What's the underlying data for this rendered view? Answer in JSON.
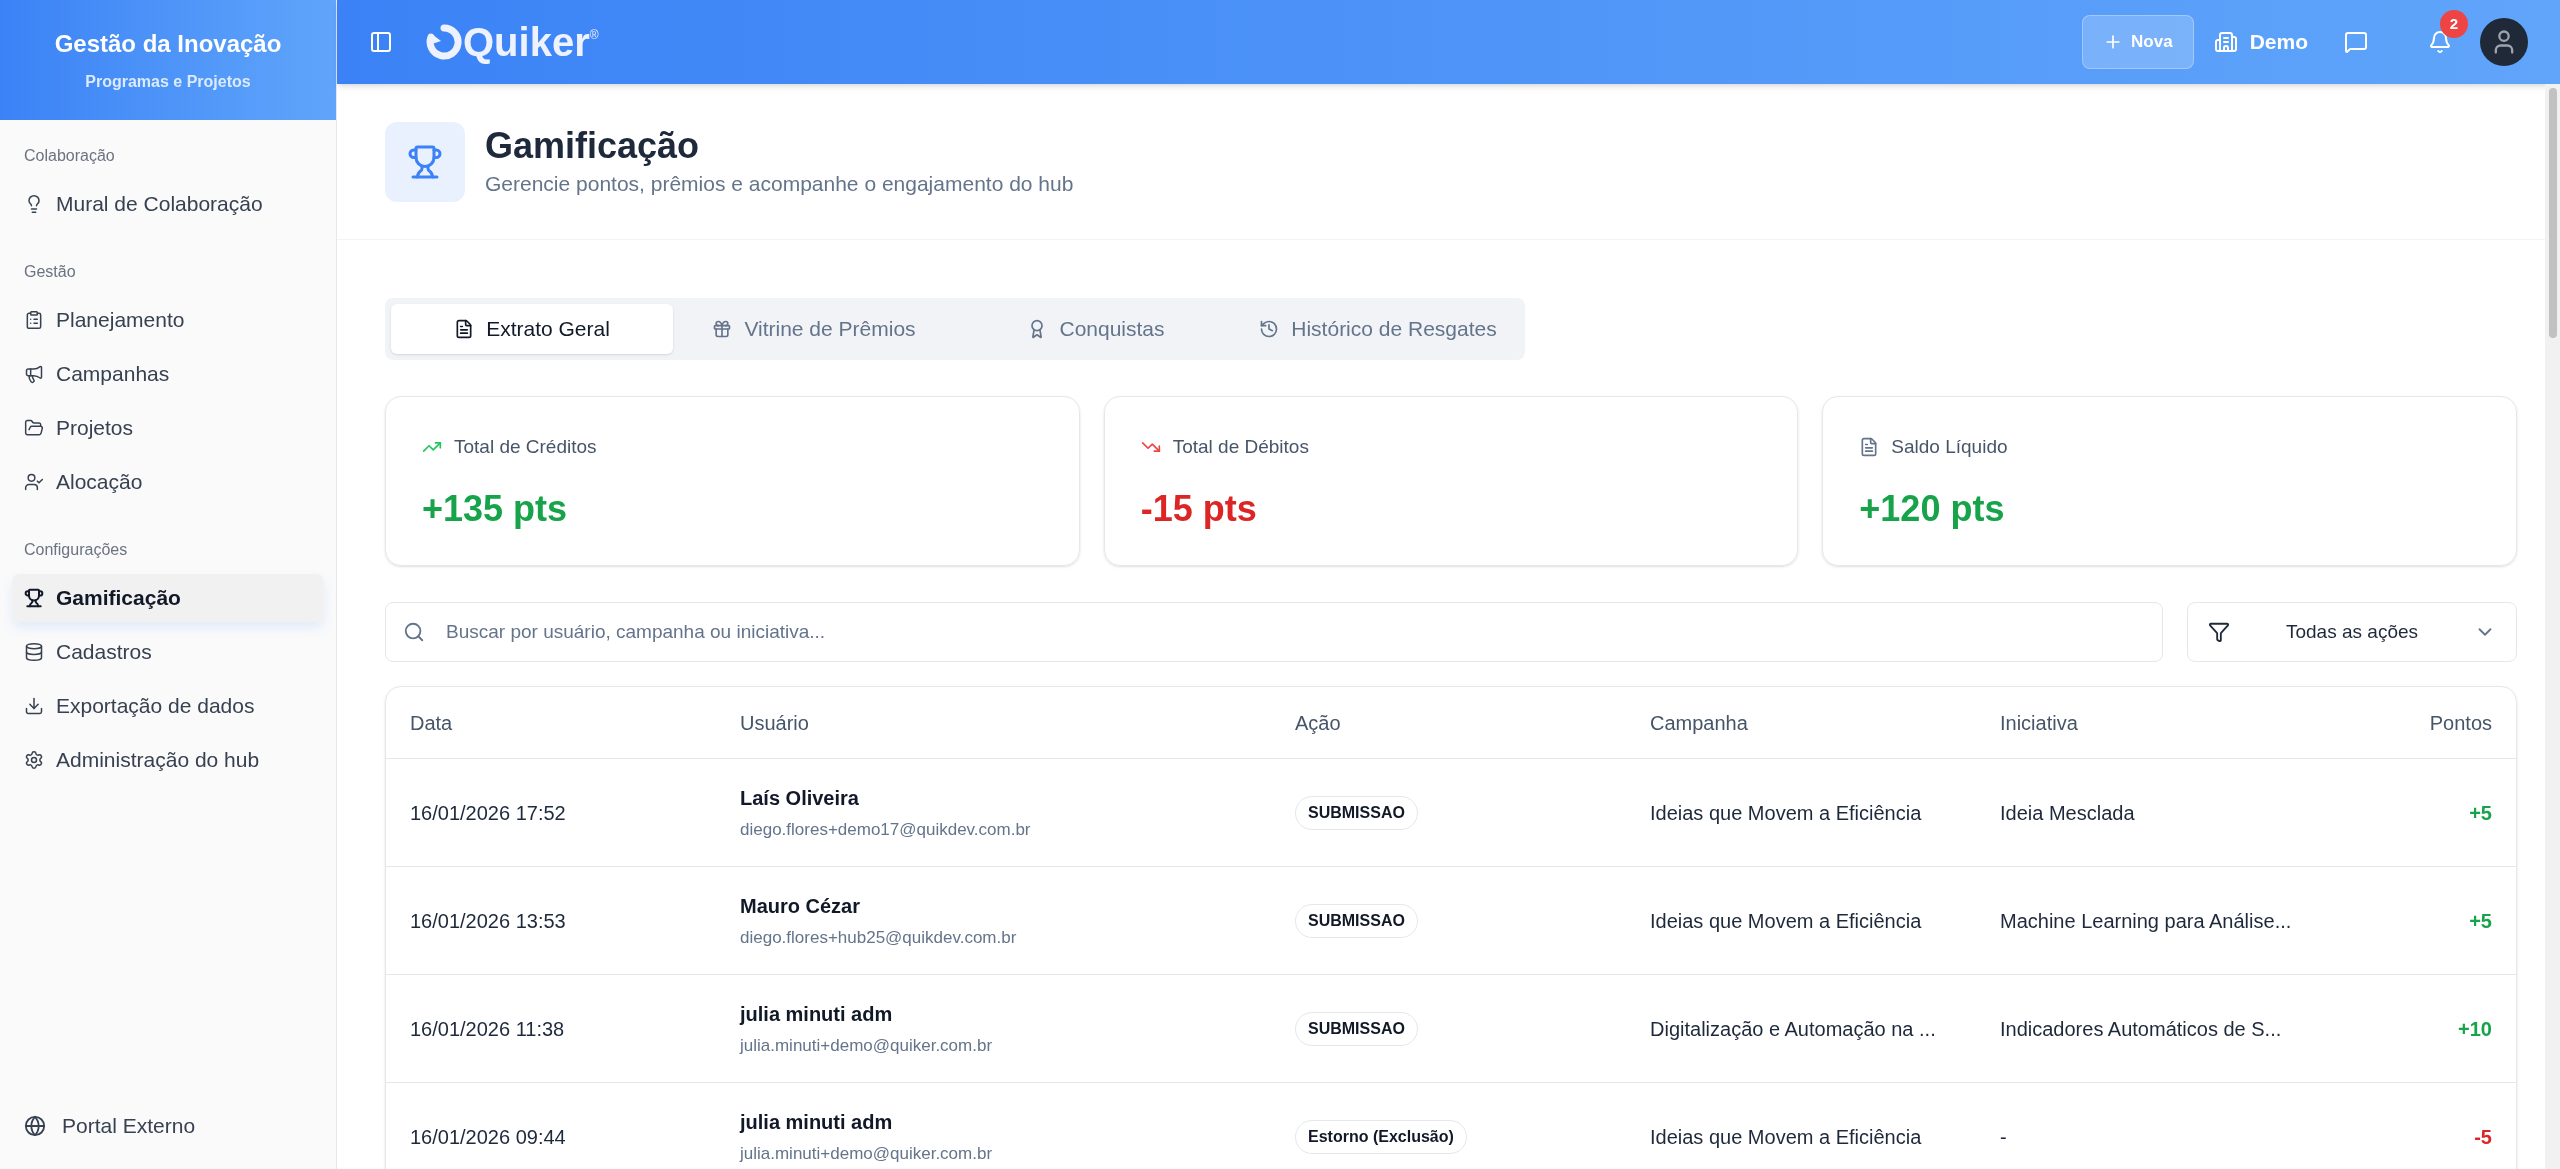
{
  "sidebar": {
    "title": "Gestão da Inovação",
    "subtitle": "Programas e Projetos",
    "sections": [
      {
        "heading": "Colaboração",
        "items": [
          {
            "label": "Mural de Colaboração",
            "selected": false
          }
        ]
      },
      {
        "heading": "Gestão",
        "items": [
          {
            "label": "Planejamento",
            "selected": false
          },
          {
            "label": "Campanhas",
            "selected": false
          },
          {
            "label": "Projetos",
            "selected": false
          },
          {
            "label": "Alocação",
            "selected": false
          }
        ]
      },
      {
        "heading": "Configurações",
        "items": [
          {
            "label": "Gamificação",
            "selected": true
          },
          {
            "label": "Cadastros",
            "selected": false
          },
          {
            "label": "Exportação de dados",
            "selected": false
          },
          {
            "label": "Administração do hub",
            "selected": false
          }
        ]
      }
    ],
    "footer": {
      "label": "Portal Externo"
    }
  },
  "topbar": {
    "logo": "Quiker",
    "logo_mark": "®",
    "new_button": "Nova",
    "org": "Demo",
    "notification_count": "2"
  },
  "header": {
    "title": "Gamificação",
    "subtitle": "Gerencie pontos, prêmios e acompanhe o engajamento do hub"
  },
  "tabs": [
    {
      "label": "Extrato Geral",
      "selected": true
    },
    {
      "label": "Vitrine de Prêmios",
      "selected": false
    },
    {
      "label": "Conquistas",
      "selected": false
    },
    {
      "label": "Histórico de Resgates",
      "selected": false
    }
  ],
  "summary": [
    {
      "kind": "credit",
      "label": "Total de Créditos",
      "value": "+135 pts"
    },
    {
      "kind": "debit",
      "label": "Total de Débitos",
      "value": "-15 pts"
    },
    {
      "kind": "balance",
      "label": "Saldo Líquido",
      "value": "+120 pts"
    }
  ],
  "search": {
    "placeholder": "Buscar por usuário, campanha ou iniciativa..."
  },
  "filter": {
    "value": "Todas as ações"
  },
  "table": {
    "columns": [
      "Data",
      "Usuário",
      "Ação",
      "Campanha",
      "Iniciativa",
      "Pontos"
    ],
    "rows": [
      {
        "date": "16/01/2026 17:52",
        "name": "Laís Oliveira",
        "email": "diego.flores+demo17@quikdev.com.br",
        "action": "SUBMISSAO",
        "campaign": "Ideias que Movem a Eficiência",
        "initiative": "Ideia Mesclada",
        "points": "+5",
        "kind": "credit"
      },
      {
        "date": "16/01/2026 13:53",
        "name": "Mauro Cézar",
        "email": "diego.flores+hub25@quikdev.com.br",
        "action": "SUBMISSAO",
        "campaign": "Ideias que Movem a Eficiência",
        "initiative": "Machine Learning para Análise...",
        "points": "+5",
        "kind": "credit"
      },
      {
        "date": "16/01/2026 11:38",
        "name": "julia minuti adm",
        "email": "julia.minuti+demo@quiker.com.br",
        "action": "SUBMISSAO",
        "campaign": "Digitalização e Automação na ...",
        "initiative": "Indicadores Automáticos de S...",
        "points": "+10",
        "kind": "credit"
      },
      {
        "date": "16/01/2026 09:44",
        "name": "julia minuti adm",
        "email": "julia.minuti+demo@quiker.com.br",
        "action": "Estorno (Exclusão)",
        "campaign": "Ideias que Movem a Eficiência",
        "initiative": "-",
        "points": "-5",
        "kind": "debit"
      }
    ]
  }
}
